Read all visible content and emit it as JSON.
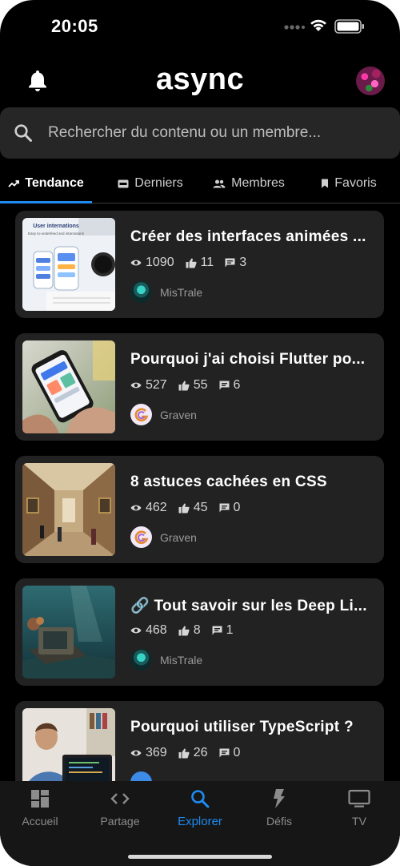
{
  "status_bar": {
    "time": "20:05"
  },
  "header": {
    "logo": "async"
  },
  "search": {
    "placeholder": "Rechercher du contenu ou un membre..."
  },
  "tabs": [
    {
      "label": "Tendance",
      "icon": "trending-up-icon",
      "active": true
    },
    {
      "label": "Derniers",
      "icon": "new-badge-icon",
      "active": false
    },
    {
      "label": "Membres",
      "icon": "people-icon",
      "active": false
    },
    {
      "label": "Favoris",
      "icon": "bookmark-icon",
      "active": false
    }
  ],
  "posts": [
    {
      "title": "Créer des interfaces animées ...",
      "views": "1090",
      "likes": "11",
      "comments": "3",
      "author": "MisTrale"
    },
    {
      "title": "Pourquoi j'ai choisi Flutter po...",
      "views": "527",
      "likes": "55",
      "comments": "6",
      "author": "Graven"
    },
    {
      "title": "8 astuces cachées en CSS",
      "views": "462",
      "likes": "45",
      "comments": "0",
      "author": "Graven"
    },
    {
      "title": "🔗  Tout savoir sur les Deep Li...",
      "views": "468",
      "likes": "8",
      "comments": "1",
      "author": "MisTrale"
    },
    {
      "title": "Pourquoi utiliser TypeScript ?",
      "views": "369",
      "likes": "26",
      "comments": "0",
      "author": ""
    }
  ],
  "thumbnail_text": {
    "line1": "User internations",
    "line2": "Easy to-underfeed and intarnations"
  },
  "bottom_nav": [
    {
      "label": "Accueil",
      "icon": "dashboard-icon",
      "active": false
    },
    {
      "label": "Partage",
      "icon": "code-icon",
      "active": false
    },
    {
      "label": "Explorer",
      "icon": "search-icon",
      "active": true
    },
    {
      "label": "Défis",
      "icon": "lightning-icon",
      "active": false
    },
    {
      "label": "TV",
      "icon": "tv-icon",
      "active": false
    }
  ],
  "colors": {
    "accent": "#1f8bf0",
    "background": "#000000",
    "card": "#222222"
  }
}
